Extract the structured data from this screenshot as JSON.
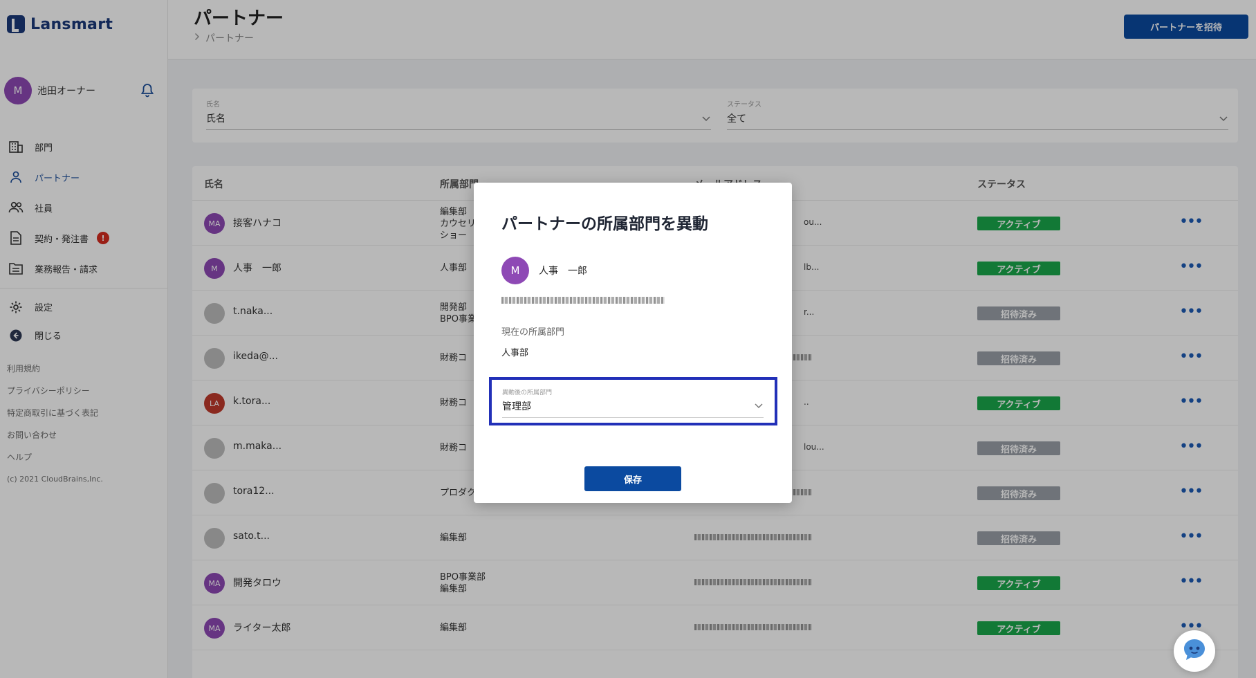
{
  "app": {
    "name": "Lansmart"
  },
  "sidebar": {
    "user": {
      "avatar": "M",
      "name": "池田オーナー",
      "avatar_color": "#8e49b5"
    },
    "nav": [
      {
        "label": "部門",
        "icon": "building-icon"
      },
      {
        "label": "パートナー",
        "icon": "person-icon"
      },
      {
        "label": "社員",
        "icon": "people-icon"
      },
      {
        "label": "契約・発注書",
        "icon": "document-icon",
        "badge": "!"
      },
      {
        "label": "業務報告・請求",
        "icon": "folder-icon"
      }
    ],
    "nav2": [
      {
        "label": "設定",
        "icon": "gear-icon"
      },
      {
        "label": "閉じる",
        "icon": "collapse-icon"
      }
    ],
    "footer": [
      "利用規約",
      "プライバシーポリシー",
      "特定商取引に基づく表記",
      "お問い合わせ",
      "ヘルプ",
      "(c) 2021 CloudBrains,Inc."
    ]
  },
  "header": {
    "title": "パートナー",
    "breadcrumb": "パートナー",
    "invite_label": "パートナーを招待"
  },
  "filters": {
    "name": {
      "label": "氏名",
      "value": "氏名"
    },
    "status": {
      "label": "ステータス",
      "value": "全て"
    }
  },
  "table": {
    "columns": [
      "氏名",
      "所属部門",
      "メールアドレス",
      "ステータス"
    ],
    "rows": [
      {
        "avatar": "MA",
        "name": "接客ハナコ",
        "dept": [
          "編集部",
          "カウセリ",
          "ショー"
        ],
        "mail": "ou...",
        "status": "アクティブ"
      },
      {
        "avatar": "M",
        "name": "人事　一郎",
        "dept": [
          "人事部"
        ],
        "mail": "lb...",
        "status": "アクティブ"
      },
      {
        "avatar": "",
        "name": "t.naka...",
        "dept": [
          "開発部",
          "BPO事業"
        ],
        "mail": "r...",
        "status": "招待済み"
      },
      {
        "avatar": "",
        "name": "ikeda@...",
        "dept": [
          "財務コ"
        ],
        "mail": "",
        "status": "招待済み"
      },
      {
        "avatar": "LA",
        "name": "k.tora...",
        "dept": [
          "財務コ"
        ],
        "mail": "..",
        "status": "アクティブ"
      },
      {
        "avatar": "",
        "name": "m.maka...",
        "dept": [
          "財務コ"
        ],
        "mail": "lou...",
        "status": "招待済み"
      },
      {
        "avatar": "",
        "name": "tora12...",
        "dept": [
          "プロダクト開発部"
        ],
        "mail": "",
        "status": "招待済み"
      },
      {
        "avatar": "",
        "name": "sato.t...",
        "dept": [
          "編集部"
        ],
        "mail": "",
        "status": "招待済み"
      },
      {
        "avatar": "MA",
        "name": "開発タロウ",
        "dept": [
          "BPO事業部",
          "編集部"
        ],
        "mail": "",
        "status": "アクティブ"
      },
      {
        "avatar": "MA",
        "name": "ライター太郎",
        "dept": [
          "編集部"
        ],
        "mail": "",
        "status": "アクティブ"
      }
    ]
  },
  "modal": {
    "title": "パートナーの所属部門を異動",
    "user_avatar": "M",
    "user_name": "人事　一郎",
    "current_label": "現在の所属部門",
    "current_value": "人事部",
    "new_label": "異動後の所属部門",
    "new_value": "管理部",
    "save_label": "保存"
  },
  "colors": {
    "brand": "#0b4aa0",
    "active": "#19a84b",
    "invited": "#9aa0a8",
    "focus": "#2230b8"
  }
}
